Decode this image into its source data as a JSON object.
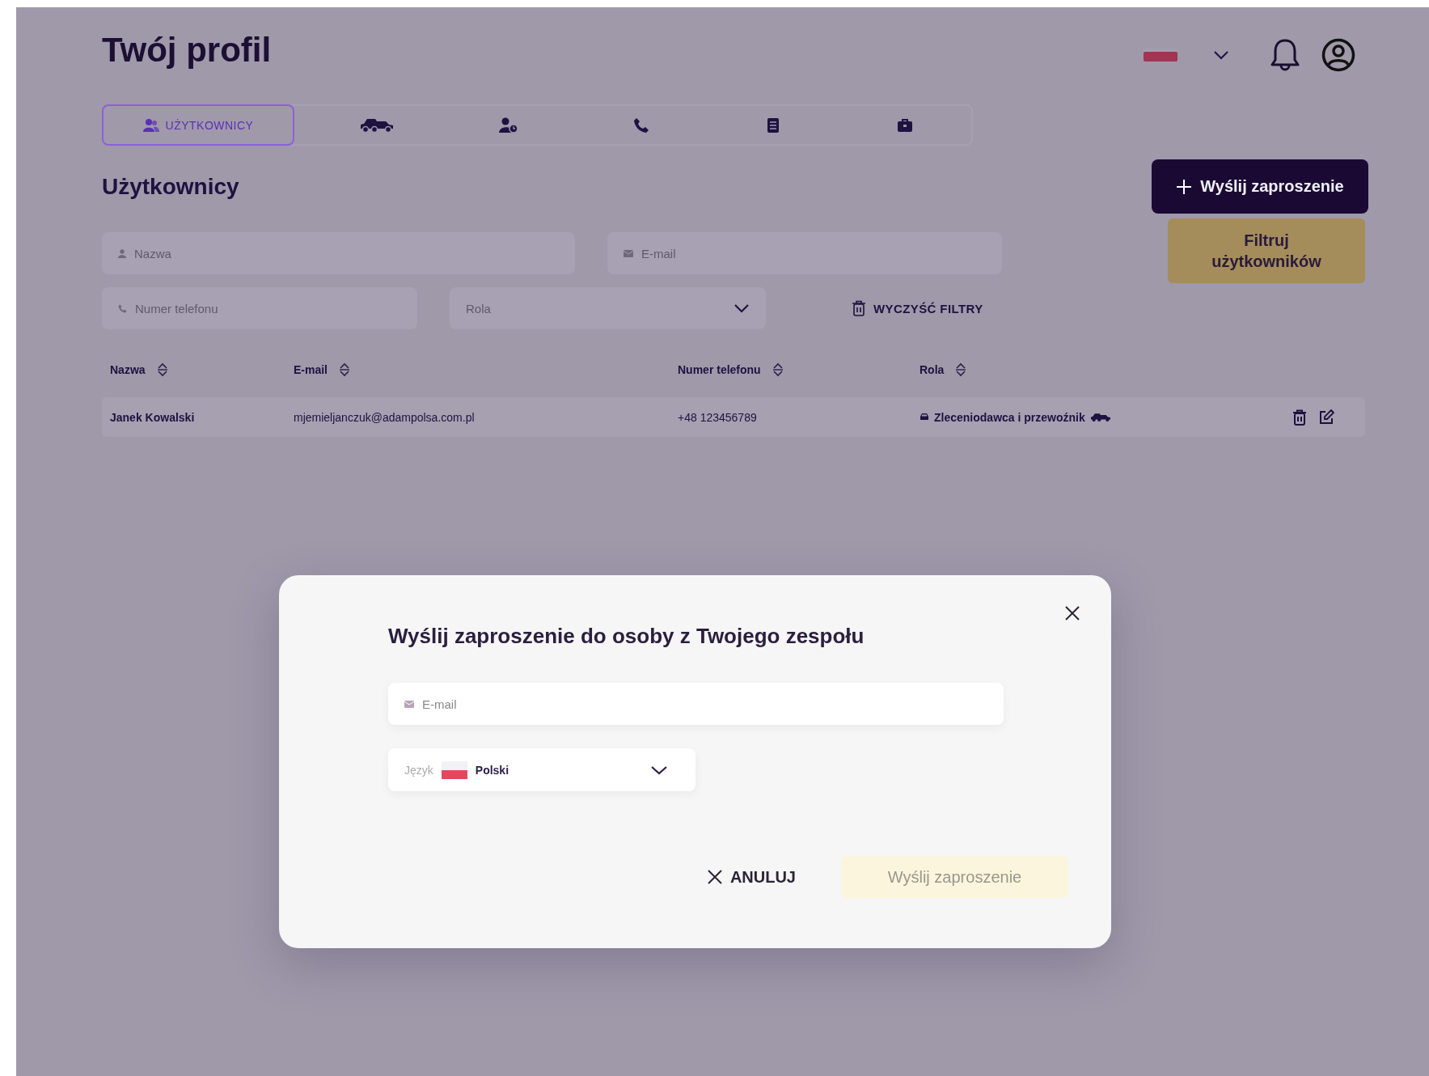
{
  "header": {
    "title": "Twój profil"
  },
  "tabs": [
    {
      "kind": "users",
      "label": "UŻYTKOWNICY",
      "selected": true
    },
    {
      "kind": "vehicles",
      "selected": false
    },
    {
      "kind": "user-clock",
      "selected": false
    },
    {
      "kind": "phone",
      "selected": false
    },
    {
      "kind": "document",
      "selected": false
    },
    {
      "kind": "briefcase",
      "selected": false
    }
  ],
  "section": {
    "title": "Użytkownicy",
    "invite_button": "Wyślij zaproszenie",
    "filter_button": "Filtruj użytkowników"
  },
  "filters": [
    {
      "kind": "name",
      "placeholder": "Nazwa"
    },
    {
      "kind": "email",
      "placeholder": "E-mail"
    },
    {
      "kind": "phone",
      "placeholder": "Numer telefonu"
    },
    {
      "kind": "role",
      "placeholder": "Rola"
    }
  ],
  "clear_filters": "WYCZYŚĆ FILTRY",
  "table": {
    "columns": [
      "Nazwa",
      "E-mail",
      "Numer telefonu",
      "Rola"
    ],
    "rows": [
      {
        "name": "Janek Kowalski",
        "email": "mjemieljanczuk@adampolsa.com.pl",
        "phone": "+48 123456789",
        "role": "Zleceniodawca i przewoźnik"
      }
    ]
  },
  "modal": {
    "title": "Wyślij zaproszenie do osoby z Twojego zespołu",
    "email_placeholder": "E-mail",
    "language_label": "Język",
    "language_value": "Polski",
    "cancel_button": "ANULUJ",
    "submit_button": "Wyślij zaproszenie",
    "submit_disabled": true
  }
}
